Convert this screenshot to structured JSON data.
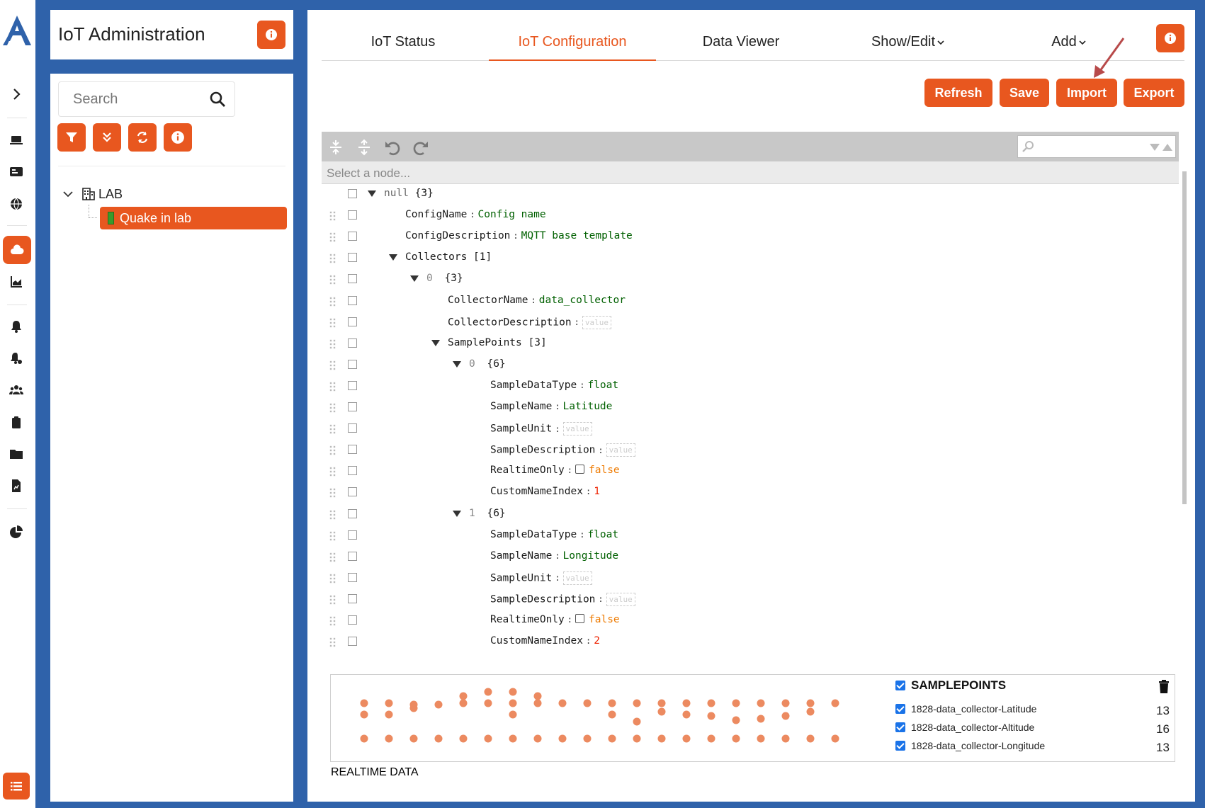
{
  "app": {
    "title": "IoT Administration"
  },
  "sidebar": {
    "search_placeholder": "Search",
    "tree": {
      "root_label": "LAB",
      "selected_device": "Quake in lab"
    }
  },
  "tabs": [
    {
      "label": "IoT Status"
    },
    {
      "label": "IoT Configuration",
      "active": true
    },
    {
      "label": "Data Viewer"
    },
    {
      "label": "Show/Edit"
    },
    {
      "label": "Add"
    }
  ],
  "actions": {
    "refresh": "Refresh",
    "save": "Save",
    "import": "Import",
    "export": "Export"
  },
  "editor": {
    "nav_placeholder": "Select a node...",
    "rows": [
      {
        "indent": 0,
        "toggle": true,
        "index": "",
        "key": "null",
        "type": "obj",
        "value": "{3}",
        "kplain": true
      },
      {
        "indent": 1,
        "key": "ConfigName",
        "type": "str",
        "value": "Config name"
      },
      {
        "indent": 1,
        "key": "ConfigDescription",
        "type": "str",
        "value": "MQTT base template"
      },
      {
        "indent": 1,
        "toggle": true,
        "key": "Collectors",
        "type": "obj",
        "value": "[1]"
      },
      {
        "indent": 2,
        "toggle": true,
        "index": "0",
        "key": "",
        "type": "obj",
        "value": "{3}"
      },
      {
        "indent": 3,
        "key": "CollectorName",
        "type": "str",
        "value": "data_collector"
      },
      {
        "indent": 3,
        "key": "CollectorDescription",
        "type": "empty",
        "value": "value"
      },
      {
        "indent": 3,
        "toggle": true,
        "key": "SamplePoints",
        "type": "obj",
        "value": "[3]"
      },
      {
        "indent": 4,
        "toggle": true,
        "index": "0",
        "key": "",
        "type": "obj",
        "value": "{6}"
      },
      {
        "indent": 5,
        "key": "SampleDataType",
        "type": "str",
        "value": "float"
      },
      {
        "indent": 5,
        "key": "SampleName",
        "type": "str",
        "value": "Latitude"
      },
      {
        "indent": 5,
        "key": "SampleUnit",
        "type": "empty",
        "value": "value"
      },
      {
        "indent": 5,
        "key": "SampleDescription",
        "type": "empty",
        "value": "value"
      },
      {
        "indent": 5,
        "key": "RealtimeOnly",
        "type": "bool",
        "value": "false"
      },
      {
        "indent": 5,
        "key": "CustomNameIndex",
        "type": "num",
        "value": "1"
      },
      {
        "indent": 4,
        "toggle": true,
        "index": "1",
        "key": "",
        "type": "obj",
        "value": "{6}"
      },
      {
        "indent": 5,
        "key": "SampleDataType",
        "type": "str",
        "value": "float"
      },
      {
        "indent": 5,
        "key": "SampleName",
        "type": "str",
        "value": "Longitude"
      },
      {
        "indent": 5,
        "key": "SampleUnit",
        "type": "empty",
        "value": "value"
      },
      {
        "indent": 5,
        "key": "SampleDescription",
        "type": "empty",
        "value": "value"
      },
      {
        "indent": 5,
        "key": "RealtimeOnly",
        "type": "bool",
        "value": "false"
      },
      {
        "indent": 5,
        "key": "CustomNameIndex",
        "type": "num",
        "value": "2"
      }
    ]
  },
  "realtime": {
    "watermark": "REALTIME DATA",
    "legend_title": "SAMPLEPOINTS",
    "series": [
      {
        "name": "1828-data_collector-Latitude",
        "count": "13"
      },
      {
        "name": "1828-data_collector-Altitude",
        "count": "16"
      },
      {
        "name": "1828-data_collector-Longitude",
        "count": "13"
      }
    ],
    "dot_color": "#ec8a60"
  },
  "colors": {
    "accent": "#e8571f",
    "frame": "#2f62aa"
  }
}
